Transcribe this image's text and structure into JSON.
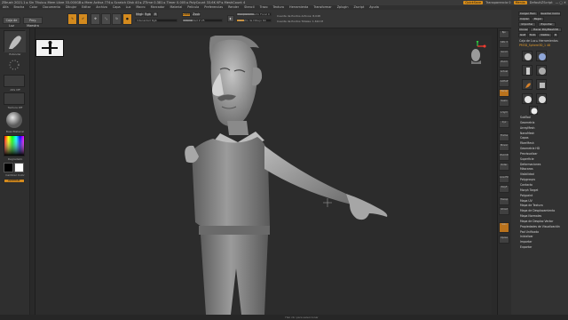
{
  "titlebar": {
    "title": "ZBrush 2021.1 ▸ Sin Título ▸ Mem Libre 33.000GB ▸ Mem Activa 774 ▸ Scratch Disk 40 ▸ ZTime 0.381 ▸ Timer 0.005 ▸ PolyCount 33.6K KP ▸ MeshCount 4",
    "quick_save": "QuickSave",
    "see_through": "Transparencia 0",
    "menus": "Menús",
    "default_zscript": "DefaultZScript"
  },
  "menubar": {
    "items": [
      "Alfa",
      "Brocha",
      "Color",
      "Documento",
      "Dibujar",
      "Editar",
      "Archivo",
      "Capa",
      "Luz",
      "Macro",
      "Marcador",
      "Material",
      "Película",
      "Preferencias",
      "Render",
      "Stencil",
      "Trazo",
      "Textura",
      "Herramienta",
      "Transformar",
      "Zplugin",
      "Zscript",
      "Ayuda"
    ]
  },
  "shelf": {
    "lightbox": "Caja de Luz",
    "projection": "Proy. Maestra",
    "edit": "Editar",
    "draw": "Dibujar",
    "move": "Mover",
    "scale": "Escalar",
    "rotate": "Rotar",
    "mrgb": "Mrgb",
    "rgb": "Rgb",
    "m": "M",
    "rgb_intensity": "Intensidad Rgb",
    "zadd": "Zadd",
    "zsub": "Zsub",
    "z_intensity": "Intensidad Z 25",
    "focal_shift": "Desplazamiento Focal 0",
    "draw_size": "Tamaño de Dibujo 64",
    "dynamic": "Dinámico",
    "active_points": "Cuenta de Puntos Activos: 8,048",
    "total_points": "Cuenta de Puntos Totales: 1.610 M"
  },
  "left_tray": {
    "brush_label": "Estándar",
    "alpha_label": "Alfa Off",
    "texture_label": "Textura Off",
    "material_label": "BasicMaterial",
    "gradient_label": "Degradado",
    "switch_color": "Cambiar Color",
    "alternate": "Alternar"
  },
  "right_panel": {
    "header": "Cargar Herr.",
    "save_as": "Guardar Como",
    "copy": "Copiar",
    "paste": "Pegar",
    "import": "Importar",
    "export": "Exportar",
    "clone": "Clonar",
    "make_polymesh": "Hacer PolyMesh3D",
    "goz": "GoZ",
    "all": "Todo",
    "visible": "Visible",
    "r": "R",
    "lightbox_tools": "Caja de Luz ▸ Herramientas",
    "current_tool": "PM3D_Sphere3D_1  48",
    "subtool_names": [
      "PM3D_Sphere3D",
      "PM3D_Sphere3D_1",
      "Cylinder3D",
      "PM3D_Sphere3D",
      "SimpleBrush",
      "PM3D_Cube3D",
      "PM3D_Sphere3D",
      "PM3D_Sphere3D",
      "PM3D_Sphere3D_1"
    ],
    "menu": [
      "SubTool",
      "Geometría",
      "ArrayMesh",
      "NanoMesh",
      "Capas",
      "FiberMesh",
      "Geometría HD",
      "Previsualizar",
      "Superficie",
      "Deformaciones",
      "Máscaras",
      "Visibilidad",
      "Polygroups",
      "Contacto",
      "Morph Target",
      "Polypaint",
      "Mapa UV",
      "Mapa de Textura",
      "Mapa de Desplazamiento",
      "Mapa Normales",
      "Mapa de Desplaz Vector",
      "Propiedades de Visualización",
      "Pad Unificado",
      "Inicializar",
      "Importar",
      "Exportar"
    ]
  },
  "right_tools": [
    "Bpr",
    "SPix 3",
    "Scroll",
    "Zoom",
    "Actual",
    "AAHalf",
    "Persp",
    "Suelo",
    "L.Sym",
    "Xyz",
    "Frame",
    "Mover",
    "ZoomD",
    "Rotar",
    "Line Fill",
    "PolyF",
    "Transp",
    "Ghost",
    "Solo",
    "Xpose"
  ],
  "status": "Haz clic para seleccionar"
}
